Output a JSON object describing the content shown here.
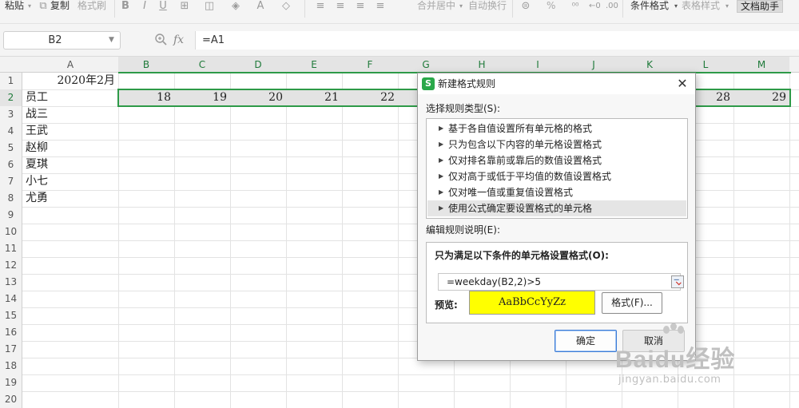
{
  "ribbon": {
    "paste": "粘贴",
    "copy": "复制",
    "format_painter": "格式刷",
    "merge_center": "合并居中",
    "wrap_text": "自动换行",
    "percent": "%",
    "conditional_format": "条件格式",
    "table_style": "表格样式",
    "doc_assistant": "文档助手"
  },
  "formula_bar": {
    "name_box": "B2",
    "fx": "fx",
    "formula": "=A1"
  },
  "sheet": {
    "columns": [
      "A",
      "B",
      "C",
      "D",
      "E",
      "F",
      "G",
      "H",
      "I",
      "J",
      "K",
      "L",
      "M"
    ],
    "rows": [
      "1",
      "2",
      "3",
      "4",
      "5",
      "6",
      "7",
      "8",
      "9",
      "10",
      "11",
      "12",
      "13",
      "14",
      "15",
      "16",
      "17",
      "18",
      "19",
      "20"
    ],
    "a1": "2020年2月",
    "names": [
      "员工",
      "战三",
      "王武",
      "赵柳",
      "夏琪",
      "小七",
      "尤勇"
    ],
    "row2_values": {
      "B": "18",
      "C": "19",
      "D": "20",
      "E": "21",
      "F": "22",
      "L": "28",
      "M": "29"
    }
  },
  "dialog": {
    "title": "新建格式规则",
    "close": "✕",
    "rule_type_label": "选择规则类型(S):",
    "rule_types": [
      "基于各自值设置所有单元格的格式",
      "只为包含以下内容的单元格设置格式",
      "仅对排名靠前或靠后的数值设置格式",
      "仅对高于或低于平均值的数值设置格式",
      "仅对唯一值或重复值设置格式",
      "使用公式确定要设置格式的单元格"
    ],
    "edit_label": "编辑规则说明(E):",
    "condition_label": "只为满足以下条件的单元格设置格式(O):",
    "formula": "=weekday(B2,2)>5",
    "preview_label": "预览:",
    "preview_text": "AaBbCcYyZz",
    "format_button": "格式(F)...",
    "ok": "确定",
    "cancel": "取消"
  },
  "watermark": {
    "brand": "Baidu经验",
    "url": "jingyan.baidu.com"
  },
  "colors": {
    "accent_green": "#2e9a48",
    "preview_fill": "#ffff00",
    "selected_row": "#e3e3e3"
  }
}
